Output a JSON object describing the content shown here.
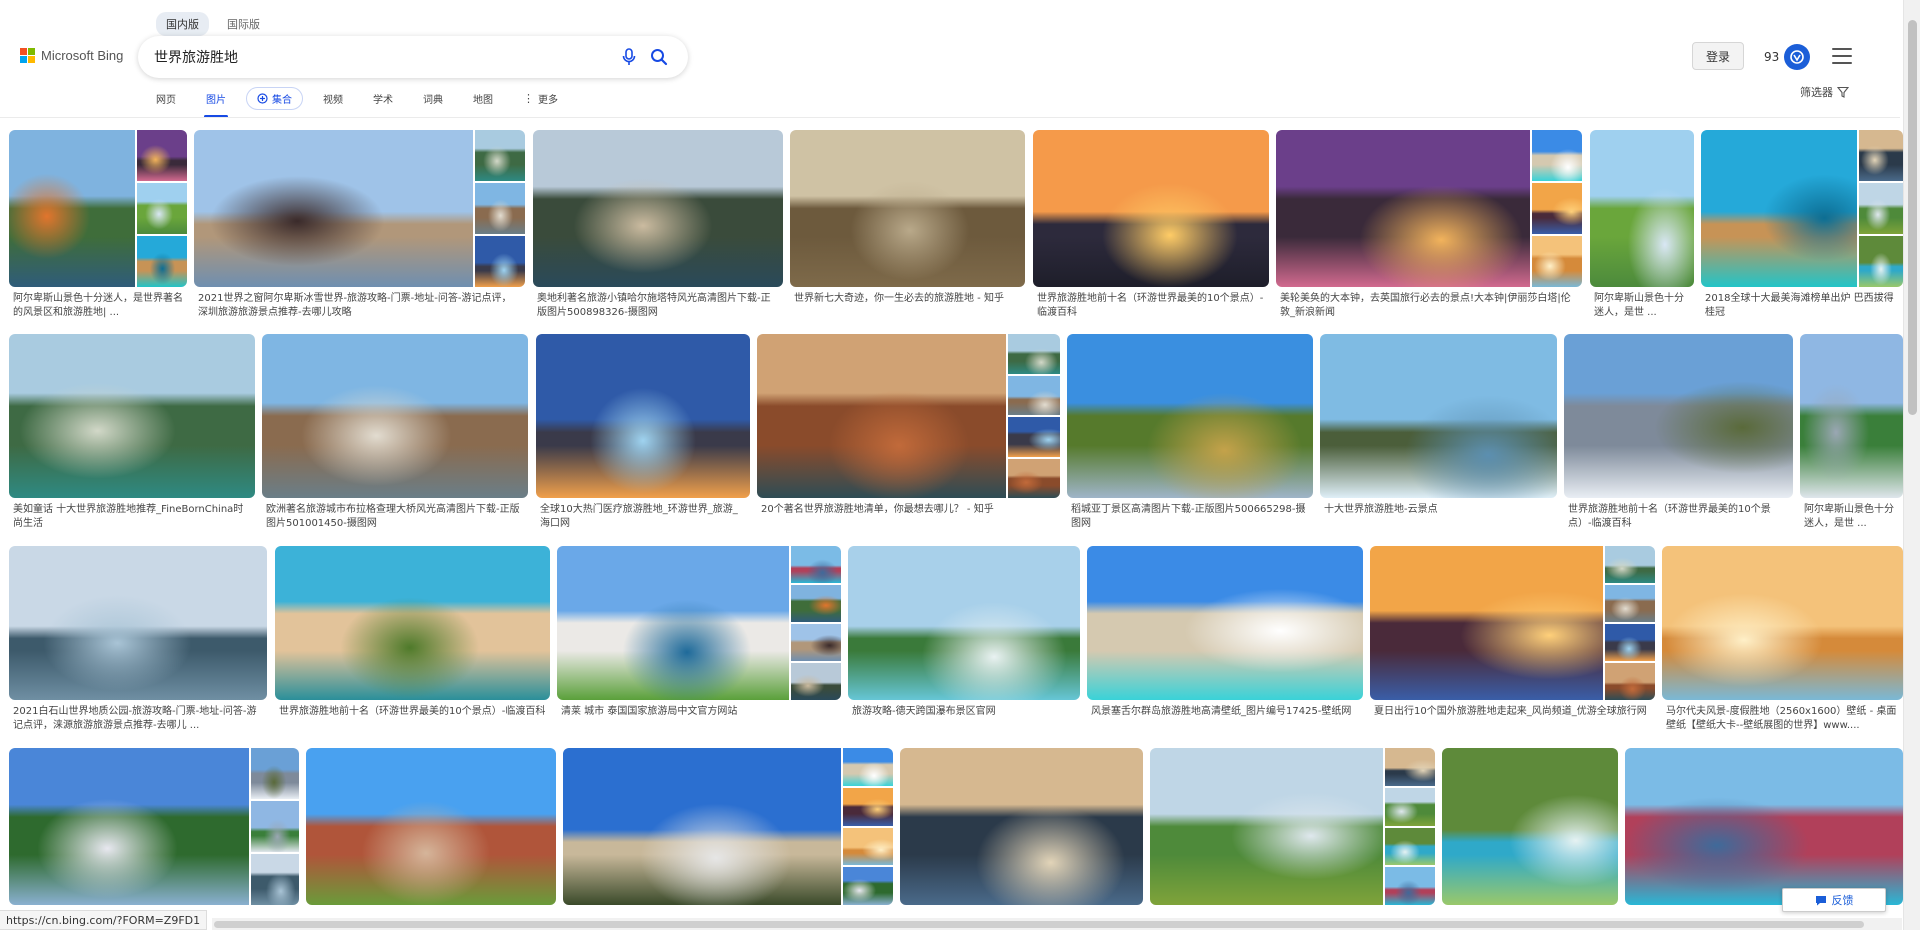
{
  "region_tabs": [
    {
      "label": "国内版",
      "active": true
    },
    {
      "label": "国际版",
      "active": false
    }
  ],
  "logo": {
    "text": "Microsoft Bing",
    "colors": [
      "#f25022",
      "#7fba00",
      "#00a4ef",
      "#ffb900"
    ]
  },
  "search": {
    "value": "世界旅游胜地"
  },
  "header": {
    "signin_label": "登录",
    "points": "93",
    "rewards_icon": "rewards-icon",
    "menu_icon": "hamburger-icon"
  },
  "nav": {
    "items": [
      {
        "label": "网页"
      },
      {
        "label": "图片",
        "active": true
      },
      {
        "label": "集合",
        "pill": true
      },
      {
        "label": "视频"
      },
      {
        "label": "学术"
      },
      {
        "label": "词典"
      },
      {
        "label": "地图"
      },
      {
        "label": "更多",
        "more": true
      }
    ],
    "filter_label": "筛选器"
  },
  "results": [
    {
      "caption": "阿尔卑斯山景色十分迷人，是世界著名的风景区和旅游胜地| ..."
    },
    {
      "caption": "2021世界之窗阿尔卑斯冰雪世界-旅游攻略-门票-地址-问答-游记点评，深圳旅游旅游景点推荐-去哪儿攻略"
    },
    {
      "caption": "奥地利著名旅游小镇哈尔施塔特风光高清图片下载-正版图片500898326-摄图网"
    },
    {
      "caption": "世界新七大奇迹，你一生必去的旅游胜地 - 知乎"
    },
    {
      "caption": "世界旅游胜地前十名（环游世界最美的10个景点）-临渡百科"
    },
    {
      "caption": "美轮美奂的大本钟，去英国旅行必去的景点!大本钟|伊丽莎白塔|伦敦_新浪新闻"
    },
    {
      "caption": "阿尔卑斯山景色十分迷人，是世 ..."
    },
    {
      "caption": "2018全球十大最美海滩榜单出炉 巴西拔得桂冠"
    },
    {
      "caption": "美如童话 十大世界旅游胜地推荐_FineBornChina时尚生活"
    },
    {
      "caption": "欧洲著名旅游城市布拉格查理大桥风光高清图片下载-正版图片501001450-摄图网"
    },
    {
      "caption": "全球10大热门医疗旅游胜地_环游世界_旅游_海口网"
    },
    {
      "caption": "20个著名世界旅游胜地清单，你最想去哪儿？ - 知乎"
    },
    {
      "caption": "稻城亚丁景区高清图片下载-正版图片500665298-摄图网"
    },
    {
      "caption": "十大世界旅游胜地-云景点"
    },
    {
      "caption": "世界旅游胜地前十名（环游世界最美的10个景点）-临渡百科"
    },
    {
      "caption": "阿尔卑斯山景色十分迷人，是世 ..."
    },
    {
      "caption": "2021白石山世界地质公园-旅游攻略-门票-地址-问答-游记点评，涞源旅游旅游景点推荐-去哪儿 ..."
    },
    {
      "caption": "世界旅游胜地前十名（环游世界最美的10个景点）-临渡百科"
    },
    {
      "caption": "清莱 城市 泰国国家旅游局中文官方网站"
    },
    {
      "caption": "旅游攻略-德天跨国瀑布景区官网"
    },
    {
      "caption": "风景塞舌尔群岛旅游胜地高清壁纸_图片编号17425-壁纸网"
    },
    {
      "caption": "夏日出行10个国外旅游胜地走起来_风尚频道_优游全球旅行网"
    },
    {
      "caption": "马尔代夫风景-度假胜地（2560x1600）壁纸 - 桌面壁纸【壁纸大卡--壁纸展图的世界】www...."
    },
    {
      "caption": ""
    },
    {
      "caption": ""
    },
    {
      "caption": ""
    },
    {
      "caption": ""
    },
    {
      "caption": ""
    },
    {
      "caption": ""
    },
    {
      "caption": ""
    }
  ],
  "status_url": "https://cn.bing.com/?FORM=Z9FD1",
  "feedback_label": "反馈"
}
